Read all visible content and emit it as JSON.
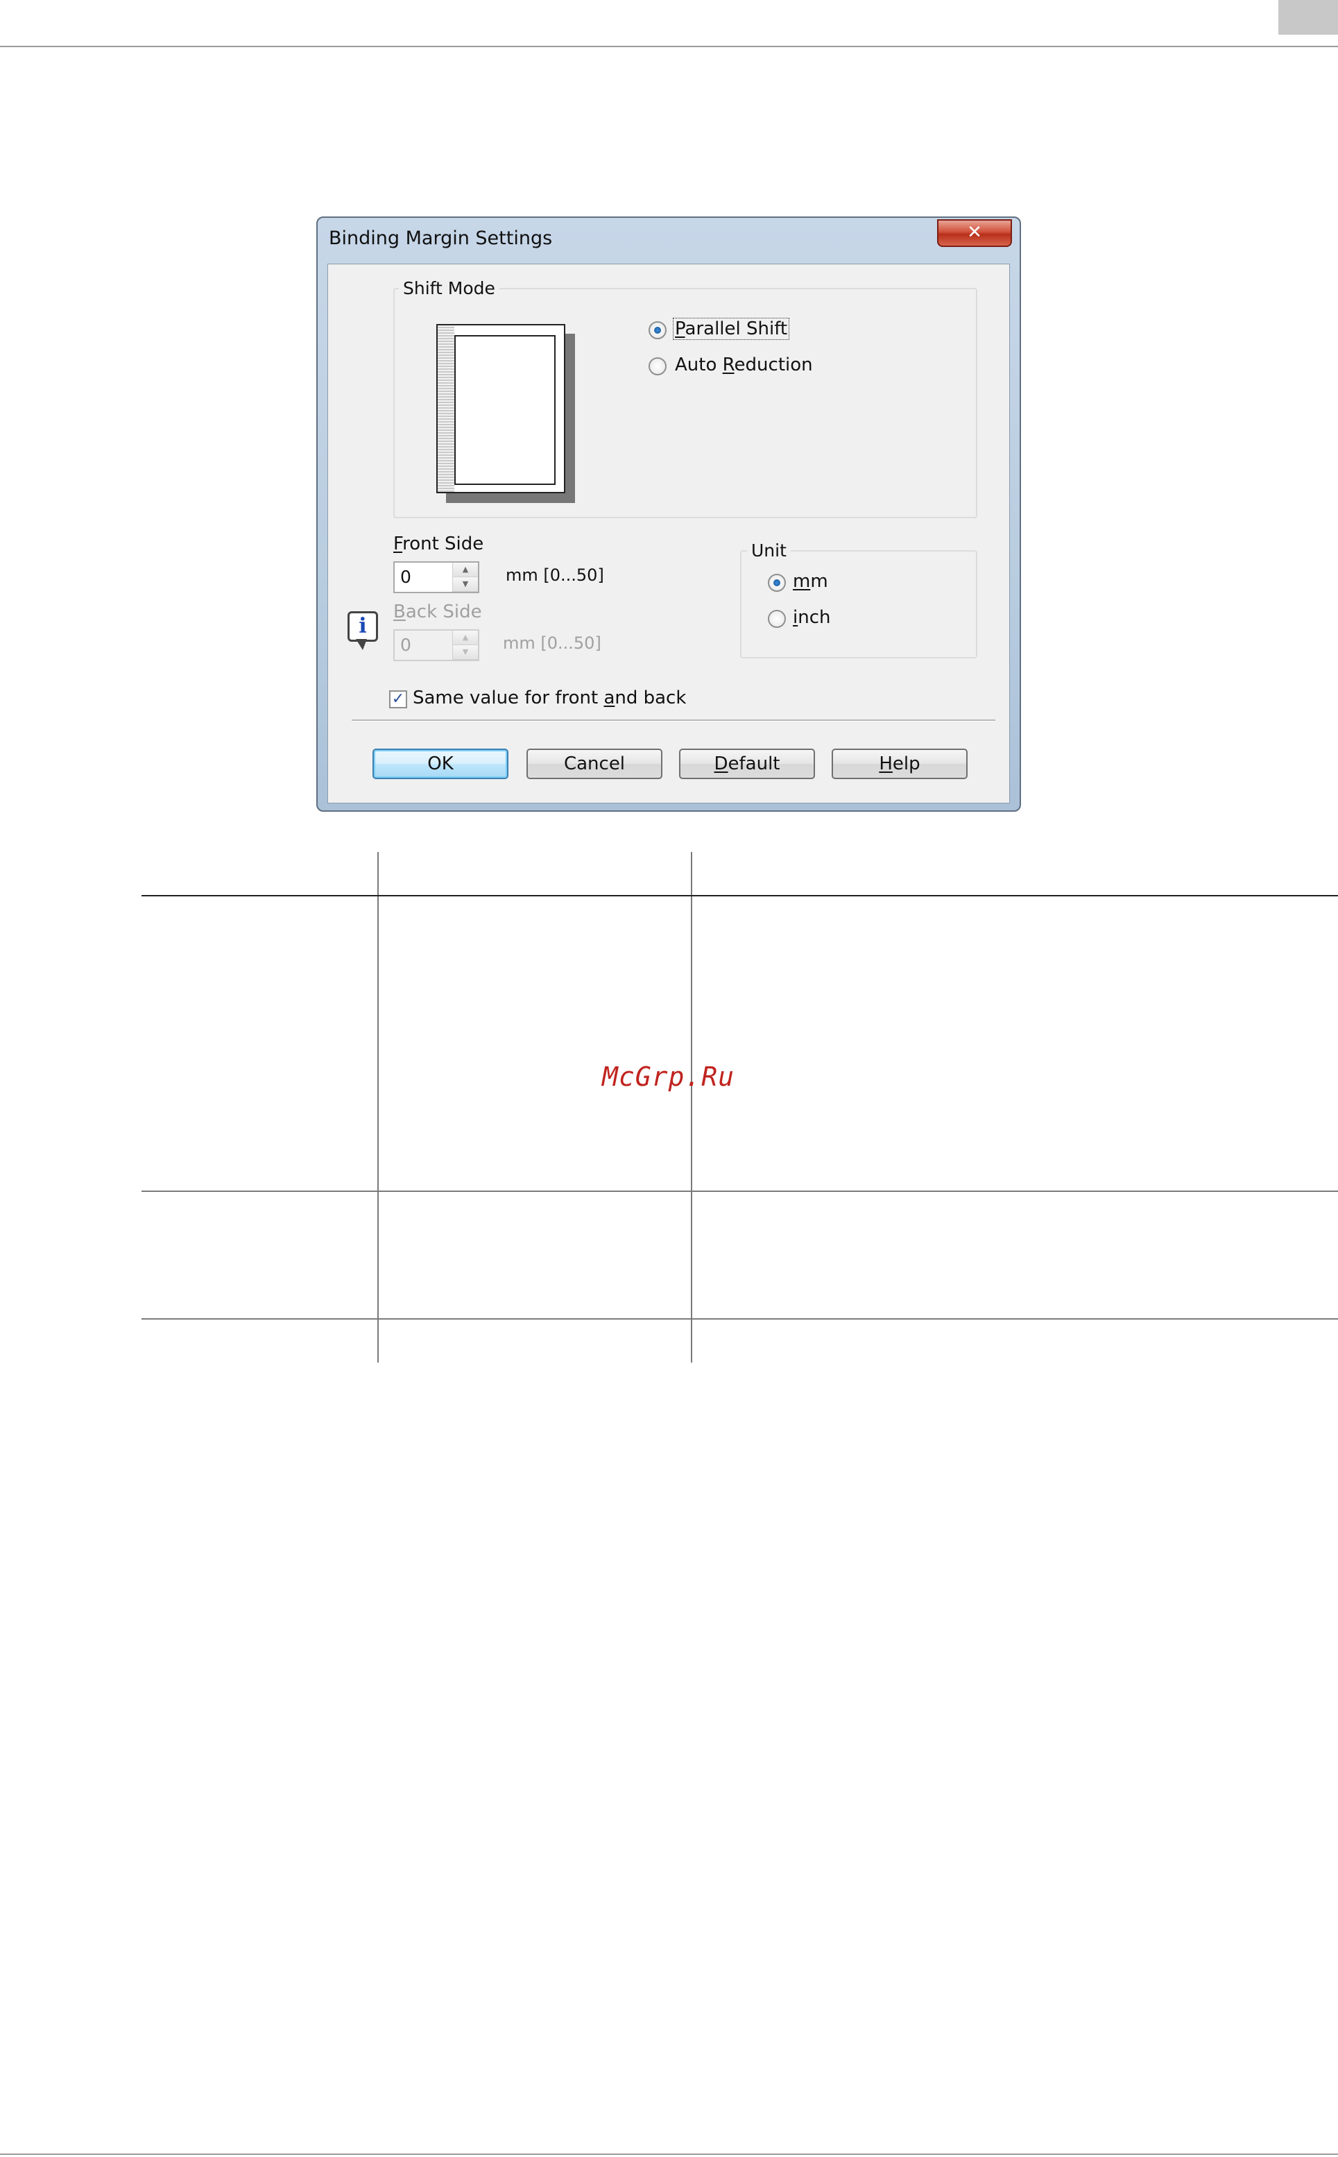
{
  "dialog": {
    "title": "Binding Margin Settings",
    "close_glyph": "✕",
    "shift_mode": {
      "legend": "Shift Mode",
      "options": [
        {
          "pre": "",
          "key": "P",
          "post": "arallel Shift",
          "selected": true
        },
        {
          "pre": "Auto ",
          "key": "R",
          "post": "eduction",
          "selected": false
        }
      ]
    },
    "front_side": {
      "key": "F",
      "label_rest": "ront Side",
      "value": "0",
      "range": "mm [0...50]"
    },
    "back_side": {
      "key": "B",
      "label_rest": "ack Side",
      "value": "0",
      "range": "mm [0...50]",
      "disabled": true
    },
    "unit": {
      "legend": "Unit",
      "options": [
        {
          "key": "m",
          "post": "m",
          "selected": true
        },
        {
          "key": "i",
          "post": "nch",
          "selected": false
        }
      ]
    },
    "same_value": {
      "pre": "Same value for front ",
      "key": "a",
      "post": "nd back",
      "checked": true,
      "check_glyph": "✓"
    },
    "info_glyph": "i",
    "buttons": {
      "ok": {
        "label": "OK"
      },
      "cancel": {
        "label": "Cancel"
      },
      "default": {
        "key": "D",
        "post": "efault"
      },
      "help": {
        "key": "H",
        "post": "elp"
      }
    }
  },
  "watermark": "McGrp.Ru"
}
